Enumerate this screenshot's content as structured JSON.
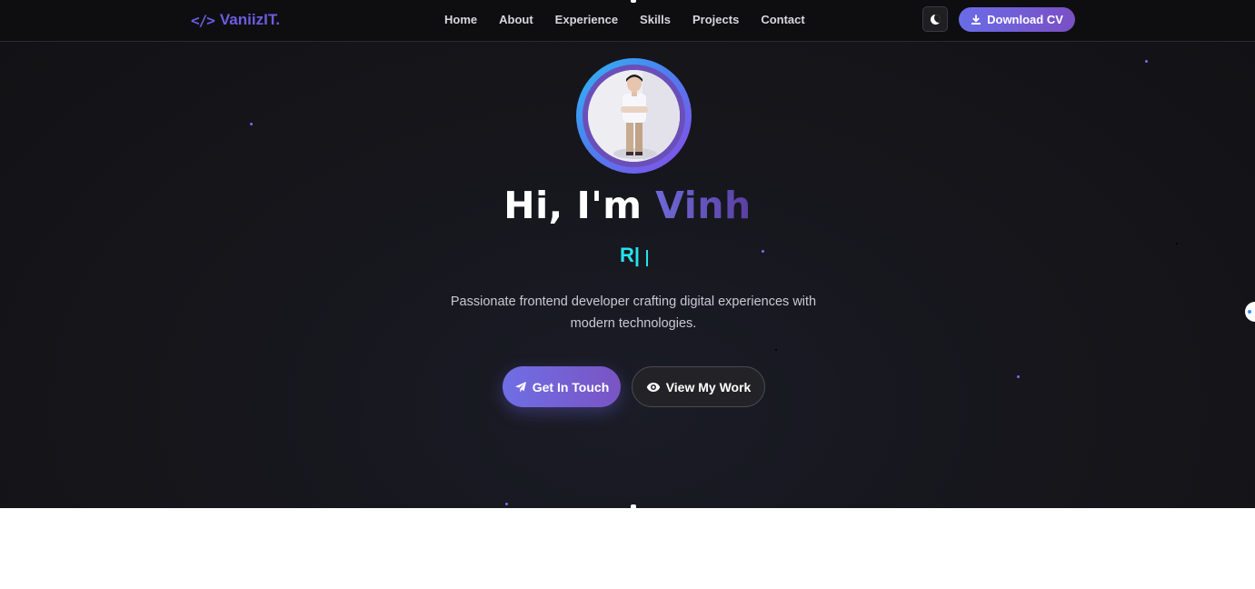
{
  "nav": {
    "logo_icon": "</>",
    "logo_text": "VaniizIT.",
    "links": [
      "Home",
      "About",
      "Experience",
      "Skills",
      "Projects",
      "Contact"
    ],
    "theme_toggle_icon": "moon-icon",
    "download_label": "Download CV",
    "download_icon": "download-icon"
  },
  "hero": {
    "greeting": "Hi, I'm ",
    "name": "Vinh",
    "typed_text": "R|",
    "tagline": "Passionate frontend developer crafting digital experiences with modern technologies.",
    "primary_button": "Get In Touch",
    "primary_icon": "paper-plane-icon",
    "secondary_button": "View My Work",
    "secondary_icon": "eye-icon"
  },
  "colors": {
    "accent_gradient_start": "#6a6ce8",
    "accent_gradient_end": "#7a4fc4",
    "typed_text": "#28e3ea",
    "background": "#16161c"
  }
}
